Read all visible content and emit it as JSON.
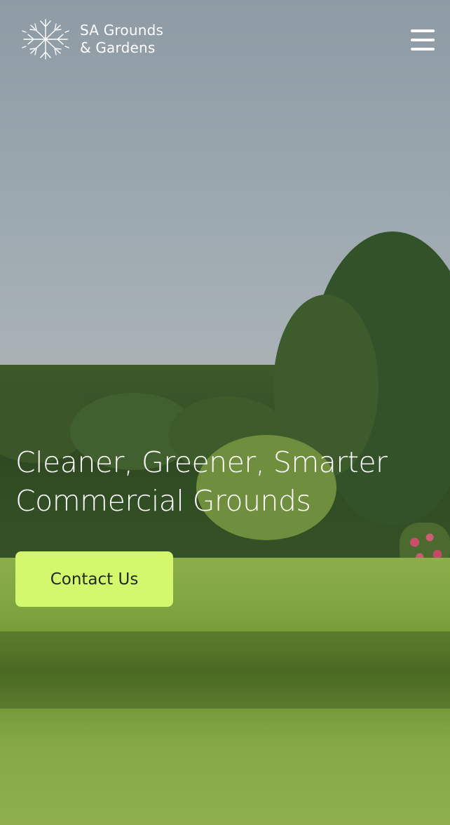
{
  "brand": {
    "line1": "SA Grounds",
    "line2": "& Gardens",
    "logo_icon": "tree-roots-icon"
  },
  "header": {
    "menu_icon": "hamburger-menu-icon"
  },
  "hero": {
    "headline_line1": "Cleaner, Greener, Smarter",
    "headline_line2": "Commercial Grounds",
    "cta_label": "Contact Us"
  },
  "colors": {
    "cta_background": "#d3f86d",
    "text_on_hero": "#ffffff"
  }
}
